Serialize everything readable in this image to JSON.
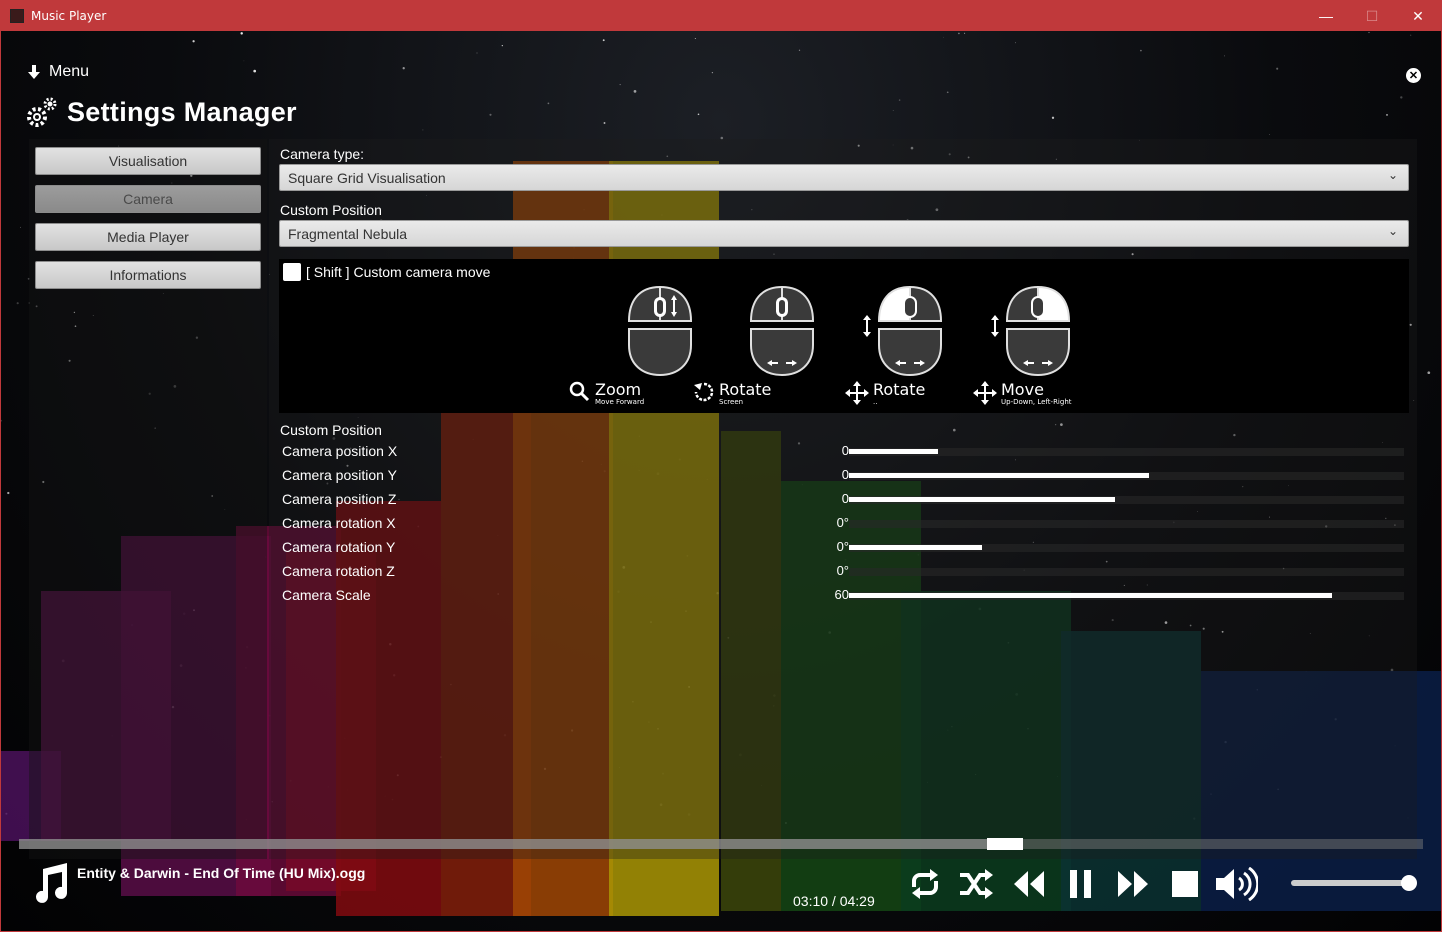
{
  "window": {
    "title": "Music Player",
    "minimize": "—",
    "maximize": "☐",
    "close": "✕"
  },
  "menu": {
    "label": "Menu"
  },
  "settings": {
    "title": "Settings Manager"
  },
  "nav": {
    "items": [
      {
        "label": "Visualisation",
        "active": false
      },
      {
        "label": "Camera",
        "active": true
      },
      {
        "label": "Media Player",
        "active": false
      },
      {
        "label": "Informations",
        "active": false
      }
    ]
  },
  "camera": {
    "camera_type_label": "Camera type:",
    "camera_type_value": "Square Grid Visualisation",
    "custom_position_label": "Custom Position",
    "custom_position_value": "Fragmental Nebula",
    "shift_checkbox_label": "[ Shift ] Custom camera move",
    "shift_checked": false,
    "mouse_hints": [
      {
        "title": "Zoom",
        "subtitle": "Move Forward",
        "icon": "magnifier-icon"
      },
      {
        "title": "Rotate",
        "subtitle": "Screen",
        "icon": "rotate-icon"
      },
      {
        "title": "Rotate",
        "subtitle": "..",
        "icon": "move-arrows-icon"
      },
      {
        "title": "Move",
        "subtitle": "Up-Down, Left-Right",
        "icon": "move-arrows-icon"
      }
    ],
    "params_label": "Custom Position",
    "params": [
      {
        "name": "Camera position X",
        "value": "0",
        "level": 0.16
      },
      {
        "name": "Camera position Y",
        "value": "0",
        "level": 0.54
      },
      {
        "name": "Camera position Z",
        "value": "0",
        "level": 0.48
      },
      {
        "name": "Camera rotation X",
        "value": "0°",
        "level": 0.0
      },
      {
        "name": "Camera rotation Y",
        "value": "0°",
        "level": 0.24
      },
      {
        "name": "Camera rotation Z",
        "value": "0°",
        "level": 0.0
      },
      {
        "name": "Camera Scale",
        "value": "60",
        "level": 0.87
      }
    ]
  },
  "player": {
    "track": "Entity & Darwin - End Of Time (HU Mix).ogg",
    "time": "03:10 / 04:29",
    "progress": 0.715,
    "volume": 1.0,
    "controls": [
      "repeat-icon",
      "shuffle-icon",
      "rewind-icon",
      "pause-icon",
      "fast-forward-icon",
      "stop-icon",
      "volume-icon"
    ]
  }
}
